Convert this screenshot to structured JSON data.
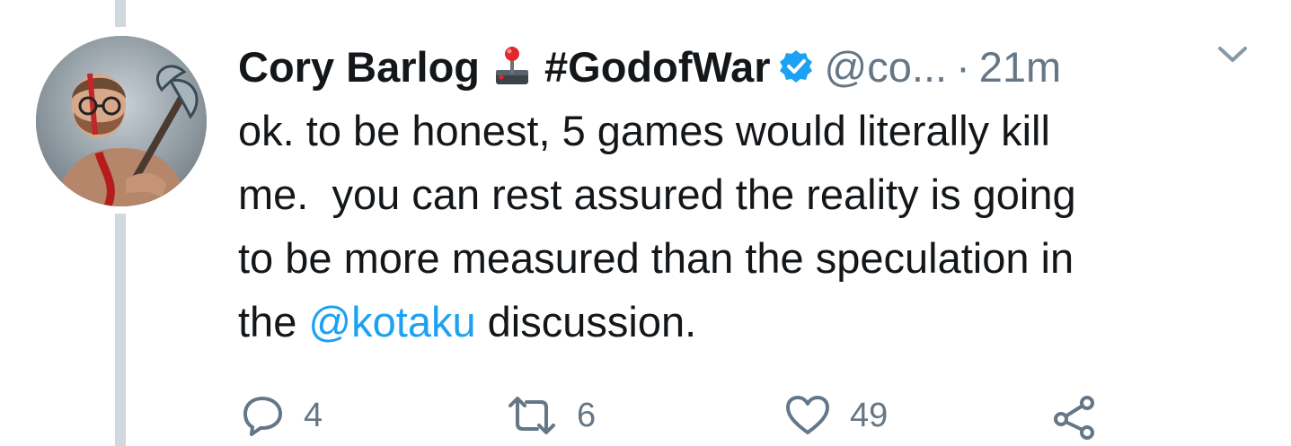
{
  "tweet": {
    "author": {
      "display_name": "Cory Barlog",
      "emoji": "joystick",
      "hashtag": "#GodofWar",
      "verified": true,
      "handle": "@co...",
      "separator": "·",
      "time": "21m"
    },
    "text": {
      "line1": "ok. to be honest, 5 games would literally kill",
      "line2": "me.  you can rest assured the reality is going",
      "line3": "to be more measured than the speculation in",
      "line4_pre": "the ",
      "line4_mention": "@kotaku",
      "line4_post": " discussion."
    },
    "actions": {
      "reply_count": "4",
      "retweet_count": "6",
      "like_count": "49"
    }
  },
  "icons": {
    "reply": "reply-icon",
    "retweet": "retweet-icon",
    "like": "heart-icon",
    "share": "share-icon",
    "more": "chevron-down-icon",
    "verified": "verified-badge-icon",
    "emoji": "joystick-icon"
  },
  "colors": {
    "accent": "#1da1f2",
    "muted": "#657786",
    "text": "#14171a",
    "thread_line": "#cfd9de"
  }
}
